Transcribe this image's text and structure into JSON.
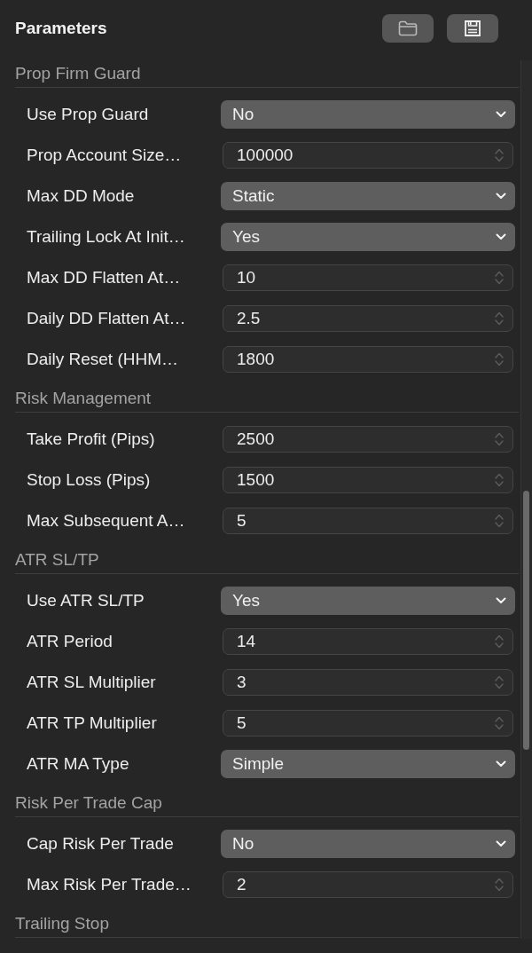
{
  "panel": {
    "title": "Parameters"
  },
  "sections": [
    {
      "title": "Prop Firm Guard",
      "params": [
        {
          "label": "Use Prop Guard",
          "kind": "dropdown",
          "value": "No"
        },
        {
          "label": "Prop Account Size…",
          "kind": "number",
          "value": "100000"
        },
        {
          "label": "Max DD Mode",
          "kind": "dropdown",
          "value": "Static"
        },
        {
          "label": "Trailing Lock At Init…",
          "kind": "dropdown",
          "value": "Yes"
        },
        {
          "label": "Max DD Flatten At…",
          "kind": "number",
          "value": "10"
        },
        {
          "label": "Daily DD Flatten At…",
          "kind": "number",
          "value": "2.5"
        },
        {
          "label": "Daily Reset (HHM…",
          "kind": "number",
          "value": "1800"
        }
      ]
    },
    {
      "title": "Risk Management",
      "params": [
        {
          "label": "Take Profit (Pips)",
          "kind": "number",
          "value": "2500"
        },
        {
          "label": "Stop Loss (Pips)",
          "kind": "number",
          "value": "1500"
        },
        {
          "label": "Max Subsequent A…",
          "kind": "number",
          "value": "5"
        }
      ]
    },
    {
      "title": "ATR SL/TP",
      "params": [
        {
          "label": "Use ATR SL/TP",
          "kind": "dropdown",
          "value": "Yes"
        },
        {
          "label": "ATR Period",
          "kind": "number",
          "value": "14"
        },
        {
          "label": "ATR SL Multiplier",
          "kind": "number",
          "value": "3"
        },
        {
          "label": "ATR TP Multiplier",
          "kind": "number",
          "value": "5"
        },
        {
          "label": "ATR MA Type",
          "kind": "dropdown",
          "value": "Simple"
        }
      ]
    },
    {
      "title": "Risk Per Trade Cap",
      "params": [
        {
          "label": "Cap Risk Per Trade",
          "kind": "dropdown",
          "value": "No"
        },
        {
          "label": "Max Risk Per Trade…",
          "kind": "number",
          "value": "2"
        }
      ]
    },
    {
      "title": "Trailing Stop"
    }
  ]
}
